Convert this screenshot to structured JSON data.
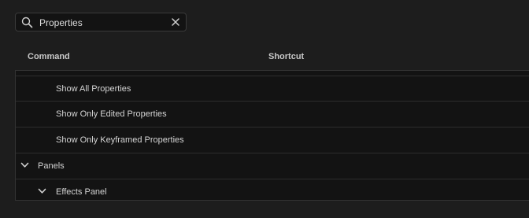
{
  "search": {
    "value": "Properties",
    "icon": "search-icon",
    "clear_icon": "close-icon"
  },
  "columns": {
    "command": "Command",
    "shortcut": "Shortcut"
  },
  "rows": [
    {
      "label": "Show All Properties",
      "level": 2
    },
    {
      "label": "Show Only Edited Properties",
      "level": 2
    },
    {
      "label": "Show Only Keyframed Properties",
      "level": 2
    },
    {
      "label": "Panels",
      "level": 0,
      "expanded": true,
      "icon": "chevron-down-icon"
    },
    {
      "label": "Effects Panel",
      "level": 1,
      "expanded": true,
      "icon": "chevron-down-icon"
    }
  ]
}
